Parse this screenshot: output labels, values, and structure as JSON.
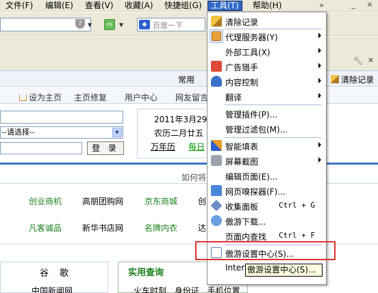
{
  "menubar": {
    "items": [
      "文件(F)",
      "编辑(E)",
      "查看(V)",
      "收藏(A)",
      "快捷组(G)",
      "工具(T)",
      "帮助(H)"
    ],
    "chevron": "»",
    "minimize": "_",
    "close": "×"
  },
  "addressbar": {
    "search_placeholder": "百度一下"
  },
  "linksbar": {
    "common": "常用",
    "clear_record": "清除记录"
  },
  "pagenav": {
    "set_home": "设为主页",
    "repair_home": "主页修复",
    "user_center": "用户中心",
    "net_friend": "网友留言"
  },
  "login": {
    "select_value": "--请选择--",
    "button": "登 录"
  },
  "date": {
    "line1": "2011年3月29",
    "line2": "农历二月廿五",
    "wannian": "万年历",
    "daily": "每日"
  },
  "howto": "如何将",
  "sites": {
    "row1": [
      "创业商机",
      "高朋团购网",
      "京东商城",
      "创"
    ],
    "row2": [
      "凡客诚品",
      "新华书店网",
      "名牌内衣",
      "达"
    ]
  },
  "bottom": {
    "left_title": "谷 歌",
    "left_link": "中国新闻网",
    "right_title": "实用查询",
    "right_links": "火车时刻 身份证 手机位置"
  },
  "tools_menu": {
    "items": [
      {
        "label": "清除记录",
        "icon": "broom-icon"
      },
      {
        "label": "代理服务器(Y)",
        "icon": "proxy-icon",
        "submenu": true,
        "checked": true
      },
      {
        "label": "外部工具(X)",
        "submenu": true
      },
      {
        "label": "广告猎手",
        "icon": "ad-hunter-icon",
        "submenu": true
      },
      {
        "label": "内容控制",
        "icon": "content-control-icon",
        "submenu": true
      },
      {
        "label": "翻译",
        "submenu": true
      },
      {
        "label": "管理插件(P)..."
      },
      {
        "label": "管理过滤包(M)..."
      },
      {
        "label": "智能填表",
        "icon": "smart-fill-icon",
        "submenu": true
      },
      {
        "label": "屏幕截图",
        "icon": "screenshot-icon",
        "submenu": true
      },
      {
        "label": "编辑页面(E)..."
      },
      {
        "label": "网页嗅探器(F)...",
        "icon": "sniffer-icon"
      },
      {
        "label": "收集面板",
        "icon": "collect-panel-icon",
        "shortcut": "Ctrl + G"
      },
      {
        "label": "傲游下载...",
        "icon": "download-icon"
      },
      {
        "label": "页面内查找",
        "shortcut": "Ctrl + F"
      },
      {
        "label": "傲游设置中心(S)...",
        "icon": "settings-center-icon"
      },
      {
        "label": "Inter"
      }
    ]
  },
  "tooltip": "傲游设置中心(S)...",
  "colors": {
    "menu_highlight": "#316ac5",
    "red_box": "#e23030",
    "link_green": "#1a7f1a"
  }
}
